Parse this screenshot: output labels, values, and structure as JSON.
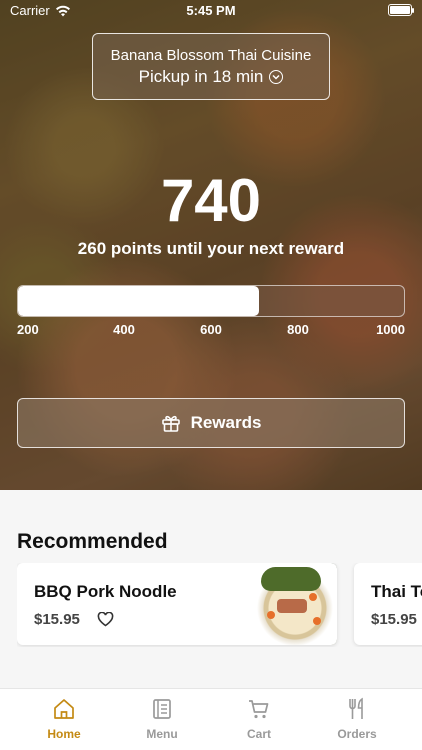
{
  "status": {
    "carrier": "Carrier",
    "time": "5:45 PM"
  },
  "store": {
    "name": "Banana Blossom Thai Cuisine",
    "pickup": "Pickup in 18 min"
  },
  "rewards": {
    "points": "740",
    "subtitle": "260 points until your next reward",
    "progress_fraction": 0.625,
    "ticks": [
      "200",
      "400",
      "600",
      "800",
      "1000"
    ],
    "button_label": "Rewards"
  },
  "recommended": {
    "title": "Recommended",
    "items": [
      {
        "name": "BBQ Pork Noodle",
        "price": "$15.95"
      },
      {
        "name": "Thai To",
        "price": "$15.95"
      }
    ]
  },
  "tabs": [
    {
      "label": "Home",
      "icon": "home-icon",
      "active": true
    },
    {
      "label": "Menu",
      "icon": "menu-icon",
      "active": false
    },
    {
      "label": "Cart",
      "icon": "cart-icon",
      "active": false
    },
    {
      "label": "Orders",
      "icon": "orders-icon",
      "active": false
    }
  ],
  "colors": {
    "accent": "#c48a14",
    "inactive_tab": "#9a9a9a"
  }
}
